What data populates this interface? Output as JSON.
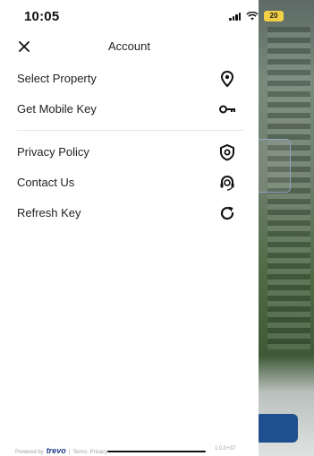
{
  "status_bar": {
    "time": "10:05",
    "battery": "20"
  },
  "header": {
    "title": "Account"
  },
  "menu": {
    "items": [
      {
        "label": "Select Property",
        "icon": "location-pin-icon"
      },
      {
        "label": "Get Mobile Key",
        "icon": "key-icon"
      },
      {
        "label": "Privacy Policy",
        "icon": "shield-icon"
      },
      {
        "label": "Contact Us",
        "icon": "support-agent-icon"
      },
      {
        "label": "Refresh Key",
        "icon": "refresh-icon"
      }
    ]
  },
  "footer": {
    "powered_by": "Powered by",
    "brand": "trevo",
    "separator": "|",
    "terms": "Terms",
    "privacy": "Privacy",
    "version": "1.0.0+37"
  },
  "colors": {
    "brand": "#1f3a8a",
    "background_button": "#1f4f8f"
  }
}
